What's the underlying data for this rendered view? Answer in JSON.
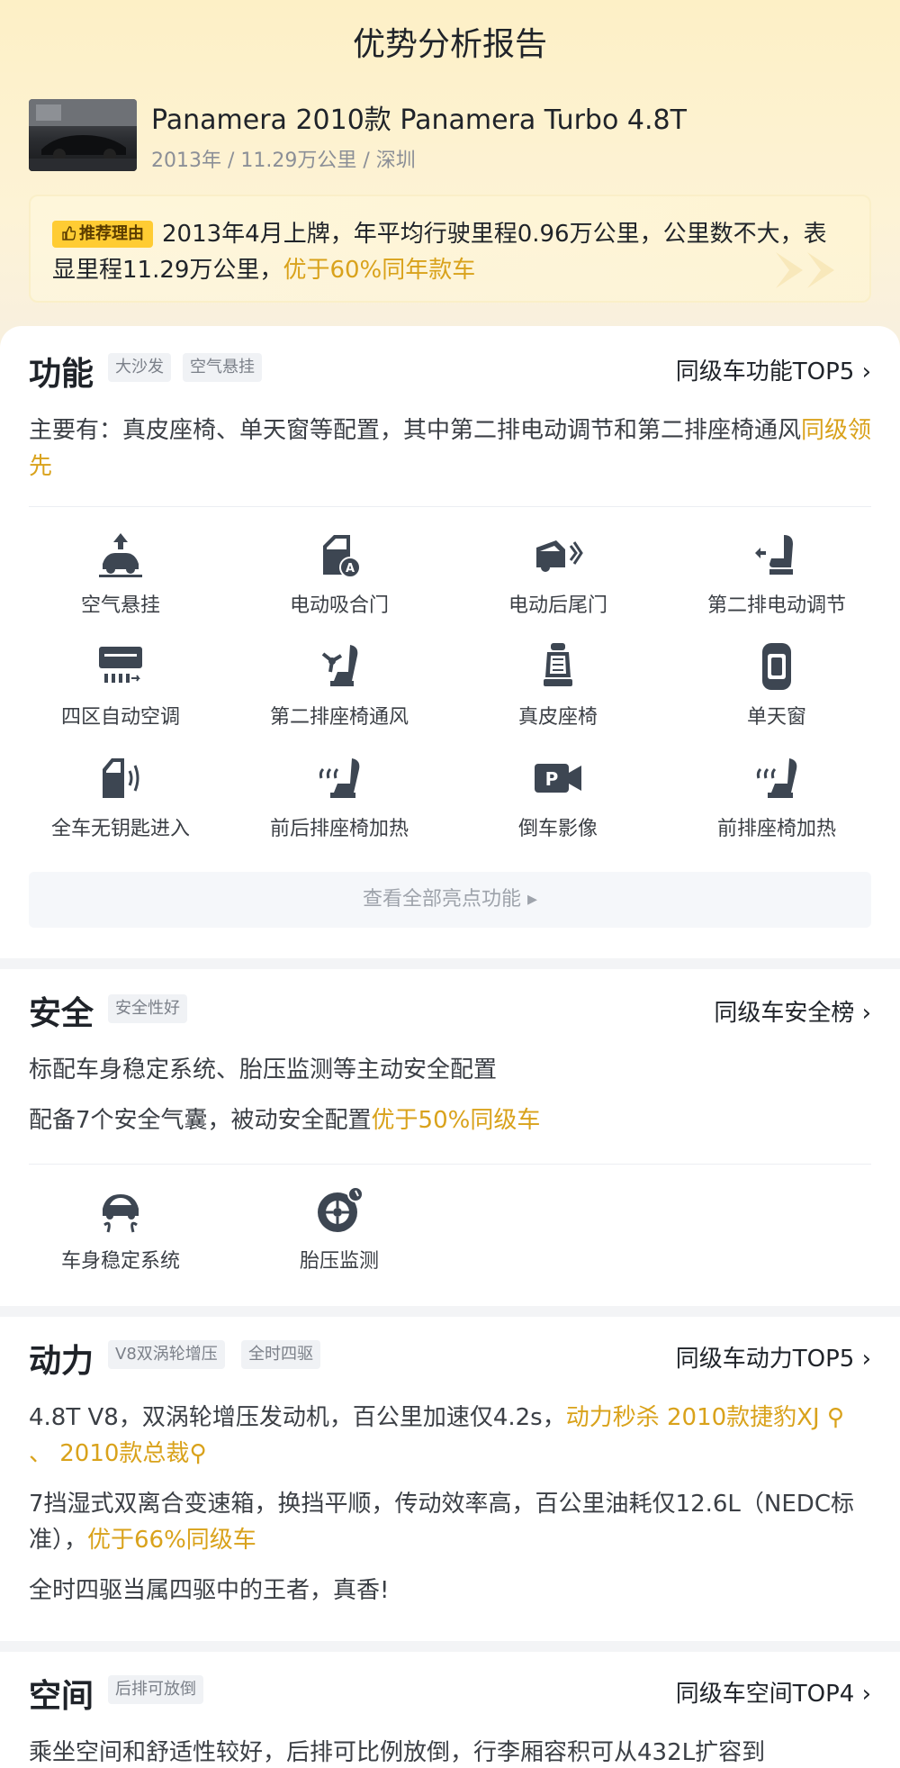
{
  "page": {
    "title": "优势分析报告"
  },
  "car": {
    "name": "Panamera 2010款 Panamera Turbo 4.8T",
    "meta": "2013年 / 11.29万公里 / 深圳"
  },
  "reason": {
    "badge": "推荐理由",
    "text": "2013年4月上牌，年平均行驶里程0.96万公里，公里数不大，表显里程11.29万公里，",
    "highlight": "优于60%同年款车"
  },
  "function_section": {
    "title": "功能",
    "tags": [
      "大沙发",
      "空气悬挂"
    ],
    "link": "同级车功能TOP5 ›",
    "summary": "主要有：真皮座椅、单天窗等配置，其中第二排电动调节和第二排座椅通风",
    "summary_highlight": "同级领先",
    "features": [
      {
        "label": "空气悬挂",
        "icon": "air-suspension-icon"
      },
      {
        "label": "电动吸合门",
        "icon": "soft-close-door-icon"
      },
      {
        "label": "电动后尾门",
        "icon": "power-tailgate-icon"
      },
      {
        "label": "第二排电动调节",
        "icon": "rear-seat-adjust-icon"
      },
      {
        "label": "四区自动空调",
        "icon": "four-zone-ac-icon"
      },
      {
        "label": "第二排座椅通风",
        "icon": "seat-ventilation-icon"
      },
      {
        "label": "真皮座椅",
        "icon": "leather-seat-icon"
      },
      {
        "label": "单天窗",
        "icon": "sunroof-icon"
      },
      {
        "label": "全车无钥匙进入",
        "icon": "keyless-entry-icon"
      },
      {
        "label": "前后排座椅加热",
        "icon": "seat-heating-icon"
      },
      {
        "label": "倒车影像",
        "icon": "reverse-camera-icon"
      },
      {
        "label": "前排座椅加热",
        "icon": "front-seat-heating-icon"
      }
    ],
    "view_all": "查看全部亮点功能 ▸"
  },
  "safety_section": {
    "title": "安全",
    "tags": [
      "安全性好"
    ],
    "link": "同级车安全榜 ›",
    "line1": "标配车身稳定系统、胎压监测等主动安全配置",
    "line2": "配备7个安全气囊，被动安全配置",
    "line2_highlight": "优于50%同级车",
    "features": [
      {
        "label": "车身稳定系统",
        "icon": "stability-control-icon"
      },
      {
        "label": "胎压监测",
        "icon": "tire-pressure-icon"
      }
    ]
  },
  "power_section": {
    "title": "动力",
    "tags": [
      "V8双涡轮增压",
      "全时四驱"
    ],
    "link": "同级车动力TOP5 ›",
    "line1": "4.8T V8，双涡轮增压发动机，百公里加速仅4.2s，",
    "line1_highlight": "动力秒杀 2010款捷豹XJ",
    "line1b_sep": " 、 ",
    "line1b_highlight": "2010款总裁",
    "line2": "7挡湿式双离合变速箱，换挡平顺，传动效率高，百公里油耗仅12.6L（NEDC标准），",
    "line2_highlight": "优于66%同级车",
    "line3": "全时四驱当属四驱中的王者，真香!"
  },
  "space_section": {
    "title": "空间",
    "tags": [
      "后排可放倒"
    ],
    "link": "同级车空间TOP4 ›",
    "line1": "乘坐空间和舒适性较好，后排可比例放倒，行李厢容积可从432L扩容到"
  },
  "colors": {
    "accent": "#d9a21b",
    "badge": "#ffcc33",
    "icon": "#3d4652"
  }
}
